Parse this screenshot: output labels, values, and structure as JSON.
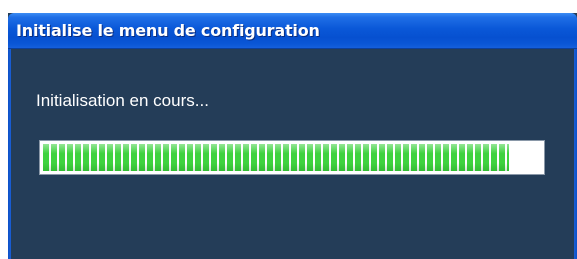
{
  "dialog": {
    "title": "Initialise le menu de configuration",
    "status_text": "Initialisation en cours...",
    "progress": {
      "fraction": 0.935
    }
  },
  "colors": {
    "title_bar": "#0a58d8",
    "body_background": "#243d58",
    "progress_fill": "#3fd23f",
    "progress_track": "#ffffff"
  }
}
